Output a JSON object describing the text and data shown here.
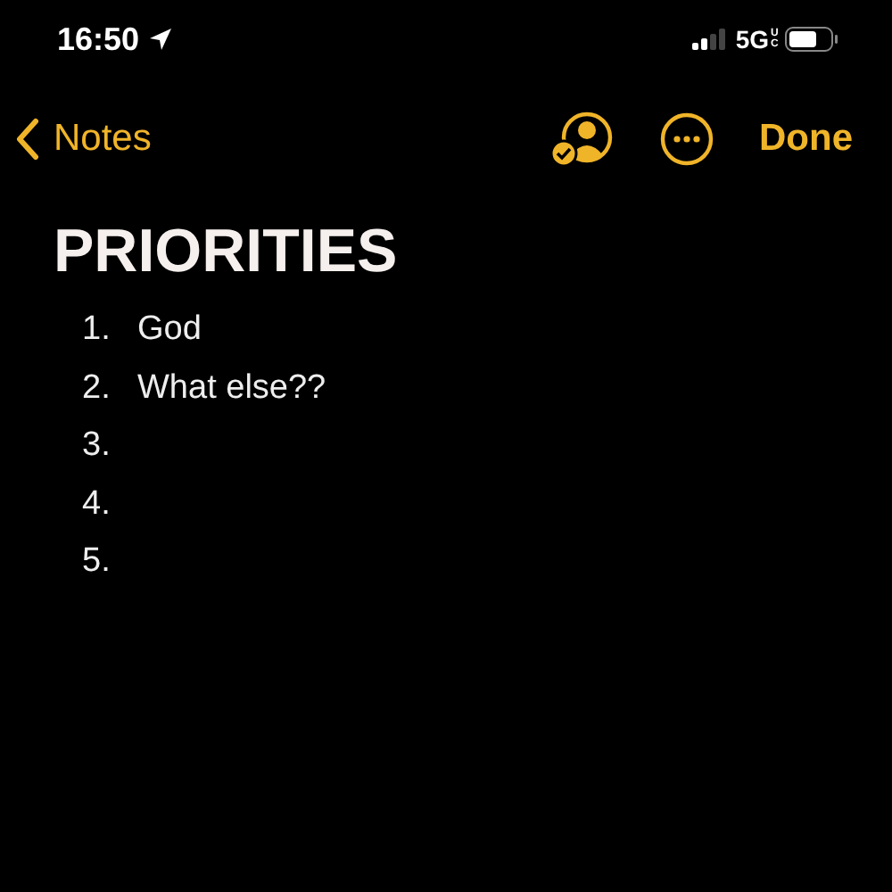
{
  "status_bar": {
    "time": "16:50",
    "network": "5G",
    "network_badge": "UC"
  },
  "nav_bar": {
    "back_label": "Notes",
    "done_label": "Done"
  },
  "note": {
    "title": "PRIORITIES",
    "items": [
      {
        "number": "1.",
        "text": "God"
      },
      {
        "number": "2.",
        "text": "What else??"
      },
      {
        "number": "3."
      },
      {
        "number": "4."
      },
      {
        "number": "5."
      }
    ]
  }
}
